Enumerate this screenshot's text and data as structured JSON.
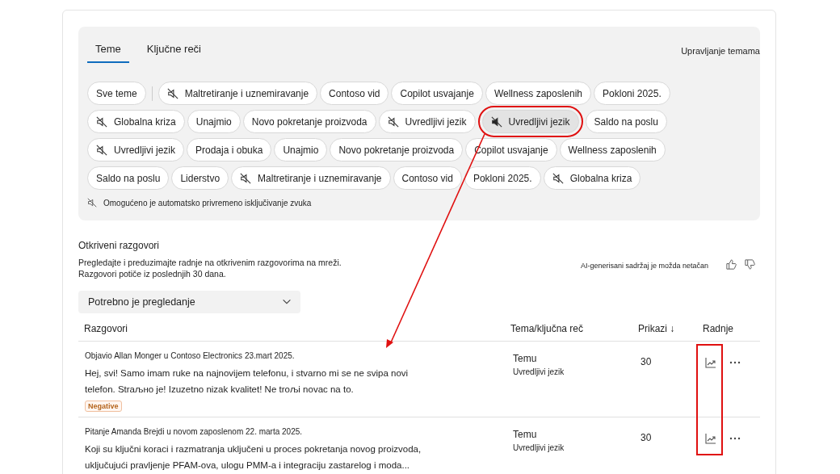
{
  "tabs": [
    {
      "label": "Teme",
      "selected": true
    },
    {
      "label": "Ključne reči",
      "selected": false
    }
  ],
  "manage_link": "Upravljanje temama",
  "chip_rows": [
    [
      {
        "label": "Sve teme",
        "kind": "plain",
        "selected": false,
        "highlighted": false,
        "divider_after": true
      },
      {
        "label": "Maltretiranje i uznemiravanje",
        "kind": "muted",
        "selected": false,
        "highlighted": false
      },
      {
        "label": "Contoso vid",
        "kind": "plain",
        "selected": false,
        "highlighted": false
      },
      {
        "label": "Copilot usvajanje",
        "kind": "plain",
        "selected": false,
        "highlighted": false
      },
      {
        "label": "Wellness zaposlenih",
        "kind": "plain",
        "selected": false,
        "highlighted": false
      },
      {
        "label": "Pokloni 2025.",
        "kind": "plain",
        "selected": false,
        "highlighted": false
      }
    ],
    [
      {
        "label": "Globalna kriza",
        "kind": "muted",
        "selected": false,
        "highlighted": false
      },
      {
        "label": "Unajmio",
        "kind": "plain",
        "selected": false,
        "highlighted": false
      },
      {
        "label": "Novo pokretanje proizvoda",
        "kind": "plain",
        "selected": false,
        "highlighted": false
      },
      {
        "label": "Uvredljivi jezik",
        "kind": "muted",
        "selected": false,
        "highlighted": false
      },
      {
        "label": "Uvredljivi jezik",
        "kind": "muted",
        "selected": true,
        "highlighted": true
      },
      {
        "label": "Saldo na poslu",
        "kind": "plain",
        "selected": false,
        "highlighted": false
      }
    ],
    [
      {
        "label": "Uvredljivi jezik",
        "kind": "muted",
        "selected": false,
        "highlighted": false
      },
      {
        "label": "Prodaja i obuka",
        "kind": "plain",
        "selected": false,
        "highlighted": false
      },
      {
        "label": "Unajmio",
        "kind": "plain",
        "selected": false,
        "highlighted": false
      },
      {
        "label": "Novo pokretanje proizvoda",
        "kind": "plain",
        "selected": false,
        "highlighted": false
      },
      {
        "label": "Copilot usvajanje",
        "kind": "plain",
        "selected": false,
        "highlighted": false
      },
      {
        "label": "Wellness zaposlenih",
        "kind": "plain",
        "selected": false,
        "highlighted": false
      }
    ],
    [
      {
        "label": "Saldo na poslu",
        "kind": "plain",
        "selected": false,
        "highlighted": false
      },
      {
        "label": "Liderstvo",
        "kind": "plain",
        "selected": false,
        "highlighted": false
      },
      {
        "label": "Maltretiranje i uznemiravanje",
        "kind": "muted",
        "selected": false,
        "highlighted": false
      },
      {
        "label": "Contoso vid",
        "kind": "plain",
        "selected": false,
        "highlighted": false
      },
      {
        "label": "Pokloni 2025.",
        "kind": "plain",
        "selected": false,
        "highlighted": false
      },
      {
        "label": "Globalna kriza",
        "kind": "muted",
        "selected": false,
        "highlighted": false
      }
    ]
  ],
  "auto_mute_note": "Omogućeno je automatsko privremeno isključivanje zvuka",
  "section": {
    "title": "Otkriveni razgovori",
    "description": [
      "Pregledajte i preduzimajte radnje na otkrivenim razgovorima na mreži.",
      "Razgovori potiče iz poslednjih 30 dana."
    ],
    "ai_note": "AI-generisani sadržaj je možda netačan"
  },
  "filter": {
    "value": "Potrebno je pregledanje"
  },
  "table": {
    "columns": [
      "Razgovori",
      "Tema/ključna reč",
      "Prikazi ↓",
      "Radnje"
    ],
    "actions_highlighted": true,
    "rows": [
      {
        "meta": "Objavio Allan Monger u Contoso Electronics 23.mart 2025.",
        "text": "Hej, svi! Samo imam ruke na najnovijem telefonu, i stvarno mi se ne svipa novi telefon. Straљно je! Izuzetno nizak kvalitet! Ne troљi novac na to.",
        "tag": "Negative",
        "topic_type": "Temu",
        "topic": "Uvredljivi jezik",
        "views": "30"
      },
      {
        "meta": "Pitanje Amanda Brejdi u novom zaposlenom 22. marta 2025.",
        "text": "Koji su ključni koraci i razmatranja uključeni u proces pokretanja novog proizvoda, uključujući pravljenje PFAM-ova, ulogu PMM-a i integraciju zastarelog i moda...",
        "topic_type": "Temu",
        "topic": "Uvredljivi jezik",
        "views": "30"
      }
    ]
  }
}
